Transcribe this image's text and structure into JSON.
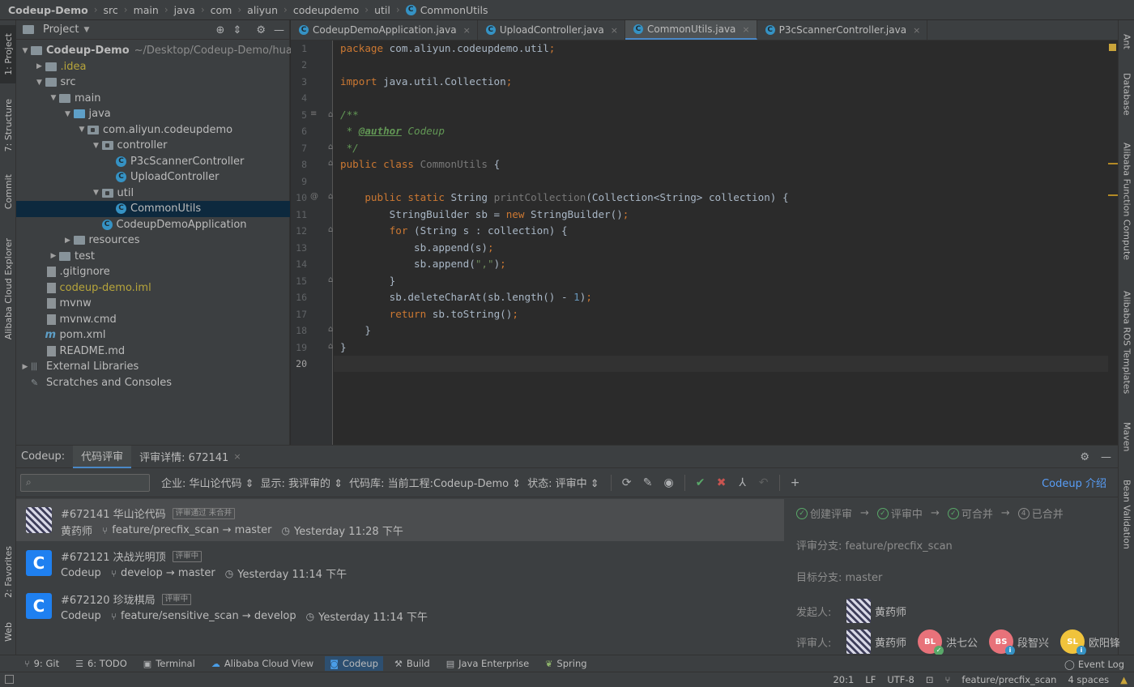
{
  "breadcrumb": [
    "Codeup-Demo",
    "src",
    "main",
    "java",
    "com",
    "aliyun",
    "codeupdemo",
    "util",
    "CommonUtils"
  ],
  "left_strip": {
    "project": "1: Project",
    "structure": "7: Structure",
    "commit": "Commit",
    "alibaba_cloud_explorer": "Alibaba Cloud Explorer",
    "favorites": "2: Favorites",
    "web": "Web"
  },
  "right_strip": {
    "ant": "Ant",
    "database": "Database",
    "function_compute": "Alibaba Function Compute",
    "ros_templates": "Alibaba ROS Templates",
    "maven": "Maven",
    "bean_validation": "Bean Validation"
  },
  "project_panel": {
    "title": "Project",
    "tree": [
      {
        "label": "Codeup-Demo",
        "suffix": "~/Desktop/Codeup-Demo/huashan",
        "indent": 0,
        "arrow": "open",
        "icon": "folder"
      },
      {
        "label": ".idea",
        "indent": 1,
        "arrow": "closed",
        "icon": "folder",
        "style": "yellow"
      },
      {
        "label": "src",
        "indent": 1,
        "arrow": "open",
        "icon": "folder"
      },
      {
        "label": "main",
        "indent": 2,
        "arrow": "open",
        "icon": "folder"
      },
      {
        "label": "java",
        "indent": 3,
        "arrow": "open",
        "icon": "folder-blue"
      },
      {
        "label": "com.aliyun.codeupdemo",
        "indent": 4,
        "arrow": "open",
        "icon": "package"
      },
      {
        "label": "controller",
        "indent": 5,
        "arrow": "open",
        "icon": "package"
      },
      {
        "label": "P3cScannerController",
        "indent": 6,
        "arrow": "none",
        "icon": "class"
      },
      {
        "label": "UploadController",
        "indent": 6,
        "arrow": "none",
        "icon": "class"
      },
      {
        "label": "util",
        "indent": 5,
        "arrow": "open",
        "icon": "package"
      },
      {
        "label": "CommonUtils",
        "indent": 6,
        "arrow": "none",
        "icon": "class",
        "selected": true
      },
      {
        "label": "CodeupDemoApplication",
        "indent": 5,
        "arrow": "none",
        "icon": "class"
      },
      {
        "label": "resources",
        "indent": 3,
        "arrow": "closed",
        "icon": "folder"
      },
      {
        "label": "test",
        "indent": 2,
        "arrow": "closed",
        "icon": "folder"
      },
      {
        "label": ".gitignore",
        "indent": 1,
        "arrow": "none",
        "icon": "file"
      },
      {
        "label": "codeup-demo.iml",
        "indent": 1,
        "arrow": "none",
        "icon": "file",
        "style": "yellow"
      },
      {
        "label": "mvnw",
        "indent": 1,
        "arrow": "none",
        "icon": "file"
      },
      {
        "label": "mvnw.cmd",
        "indent": 1,
        "arrow": "none",
        "icon": "file"
      },
      {
        "label": "pom.xml",
        "indent": 1,
        "arrow": "none",
        "icon": "maven-file"
      },
      {
        "label": "README.md",
        "indent": 1,
        "arrow": "none",
        "icon": "file"
      },
      {
        "label": "External Libraries",
        "indent": 0,
        "arrow": "closed",
        "icon": "libraries"
      },
      {
        "label": "Scratches and Consoles",
        "indent": 0,
        "arrow": "none",
        "icon": "scratches"
      }
    ]
  },
  "editor": {
    "tabs": [
      {
        "label": "CodeupDemoApplication.java",
        "active": false
      },
      {
        "label": "UploadController.java",
        "active": false
      },
      {
        "label": "CommonUtils.java",
        "active": true
      },
      {
        "label": "P3cScannerController.java",
        "active": false
      }
    ],
    "line_numbers": [
      "1",
      "2",
      "3",
      "4",
      "5",
      "6",
      "7",
      "8",
      "9",
      "10",
      "11",
      "12",
      "13",
      "14",
      "15",
      "16",
      "17",
      "18",
      "19",
      "20"
    ],
    "current_line": 20
  },
  "codeup": {
    "label": "Codeup:",
    "tab_reviews": "代码评审",
    "tab_detail": "评审详情: 672141",
    "search_placeholder": "",
    "filters": {
      "enterprise": "企业: 华山论代码",
      "show": "显示: 我评审的",
      "repo": "代码库: 当前工程:Codeup-Demo",
      "status": "状态: 评审中"
    },
    "intro_link": "Codeup 介绍",
    "reviews": [
      {
        "title": "#672141 华山论代码",
        "badge": "评审通过 未合并",
        "author": "黄药师",
        "branch": "feature/precfix_scan → master",
        "time": "Yesterday 11:28 下午",
        "avatar": "photo"
      },
      {
        "title": "#672121 决战光明顶",
        "badge": "评审中",
        "author": "Codeup",
        "branch": "develop → master",
        "time": "Yesterday 11:14 下午",
        "avatar": "codeup"
      },
      {
        "title": "#672120 珍珑棋局",
        "badge": "评审中",
        "author": "Codeup",
        "branch": "feature/sensitive_scan → develop",
        "time": "Yesterday 11:14 下午",
        "avatar": "codeup"
      }
    ],
    "detail": {
      "steps": [
        "创建评审",
        "评审中",
        "可合并",
        "已合并"
      ],
      "step_four_number": "4",
      "review_branch": "评审分支: feature/precfix_scan",
      "target_branch": "目标分支: master",
      "initiator_label": "发起人:",
      "initiator": "黄药师",
      "reviewers_label": "评审人:",
      "reviewers": [
        {
          "name": "黄药师",
          "initials": "",
          "color": "photo",
          "mark": ""
        },
        {
          "name": "洪七公",
          "initials": "BL",
          "color": "#e8727a",
          "mark": "check"
        },
        {
          "name": "段智兴",
          "initials": "BS",
          "color": "#e8727a",
          "mark": "info"
        },
        {
          "name": "欧阳锋",
          "initials": "SL",
          "color": "#f0c33c",
          "mark": "info"
        }
      ]
    }
  },
  "tool_windows": [
    {
      "label": "9: Git",
      "icon": "git-branch-icon"
    },
    {
      "label": "6: TODO",
      "icon": "list-icon"
    },
    {
      "label": "Terminal",
      "icon": "terminal-icon"
    },
    {
      "label": "Alibaba Cloud View",
      "icon": "cloud-icon"
    },
    {
      "label": "Codeup",
      "icon": "codeup-icon",
      "active": true
    },
    {
      "label": "Build",
      "icon": "hammer-icon"
    },
    {
      "label": "Java Enterprise",
      "icon": "enterprise-icon"
    },
    {
      "label": "Spring",
      "icon": "spring-icon"
    }
  ],
  "event_log": "Event Log",
  "status_bar": {
    "position": "20:1",
    "line_sep": "LF",
    "encoding": "UTF-8",
    "branch": "feature/precfix_scan",
    "indent": "4 spaces"
  },
  "colors": {
    "accent": "#4a88c7",
    "link": "#589df6",
    "ok": "#59a869",
    "error": "#c75450",
    "selection": "#0d293e"
  }
}
